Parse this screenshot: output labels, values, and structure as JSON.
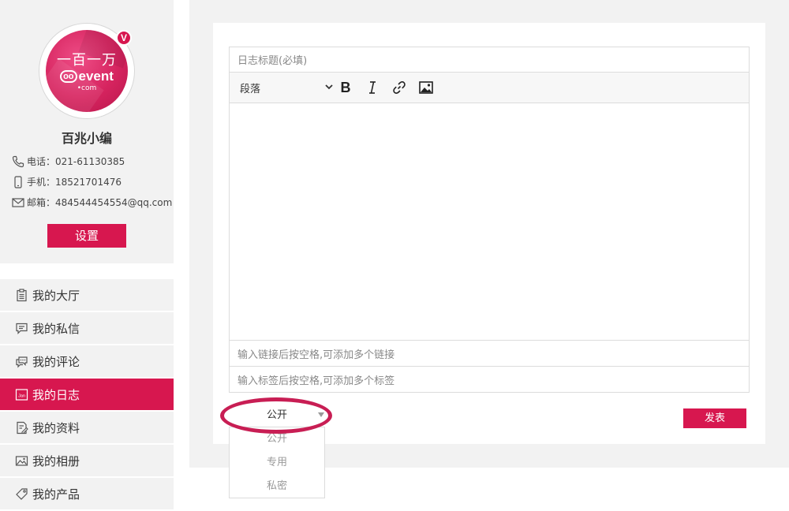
{
  "profile": {
    "avatar_logo_cn": "一百一万",
    "avatar_logo_en": "event",
    "avatar_logo_com": "•com",
    "verified_badge": "V",
    "name": "百兆小编",
    "phone": "电话：021-61130385",
    "mobile": "手机：18521701476",
    "email": "邮箱：484544454554@qq.com",
    "settings_label": "设置"
  },
  "nav": {
    "items": [
      {
        "label": "我的大厅",
        "icon": "clipboard-icon"
      },
      {
        "label": "我的私信",
        "icon": "message-icon"
      },
      {
        "label": "我的评论",
        "icon": "comments-icon"
      },
      {
        "label": "我的日志",
        "icon": "calendar-icon",
        "active": true
      },
      {
        "label": "我的资料",
        "icon": "profile-doc-icon"
      },
      {
        "label": "我的相册",
        "icon": "photo-icon"
      },
      {
        "label": "我的产品",
        "icon": "tag-icon"
      }
    ]
  },
  "editor": {
    "title_placeholder": "日志标题(必填)",
    "paragraph_label": "段落",
    "links_placeholder": "输入链接后按空格,可添加多个链接",
    "tags_placeholder": "输入标签后按空格,可添加多个标签"
  },
  "visibility": {
    "selected": "公开",
    "options": [
      "公开",
      "专用",
      "私密"
    ]
  },
  "publish_label": "发表",
  "colors": {
    "accent": "#d7174f",
    "panel_bg": "#f2f2f2",
    "highlight_ellipse": "#c81e54"
  }
}
